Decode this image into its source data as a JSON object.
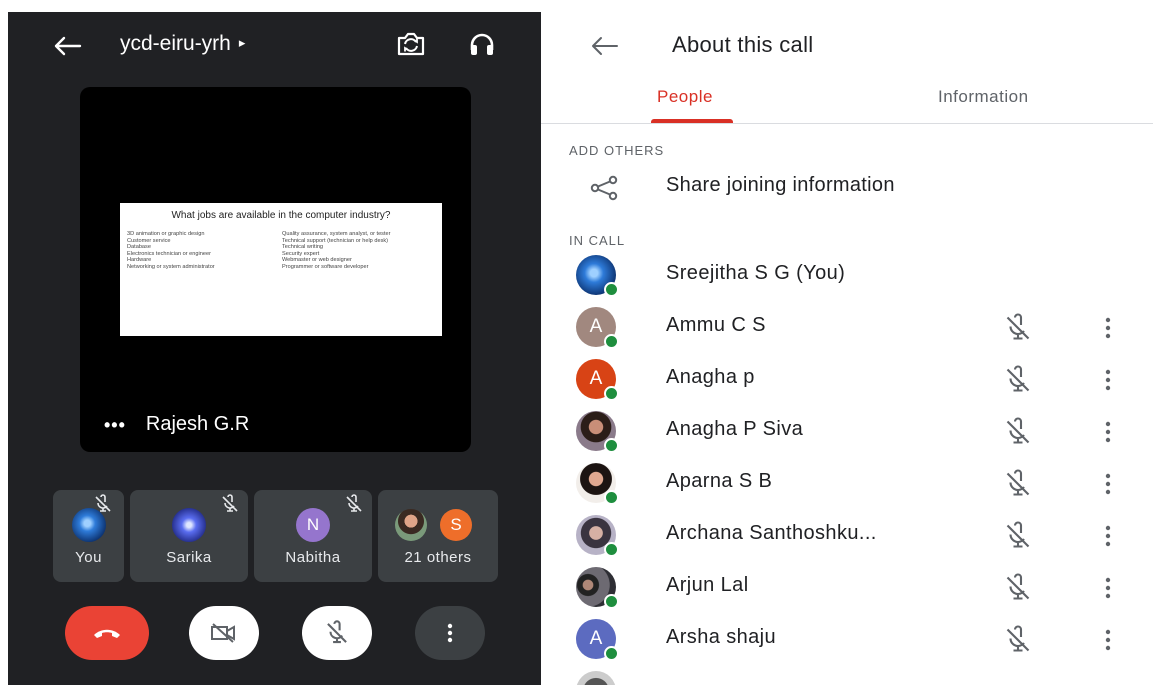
{
  "left": {
    "meeting_code": "ycd-eiru-yrh",
    "meeting_code_caret": "▸",
    "slide": {
      "title": "What jobs are available in the computer industry?",
      "left_items": [
        "3D animation or graphic design",
        "Customer service",
        "Database",
        "Electronics technician or engineer",
        "Hardware",
        "Networking or system administrator"
      ],
      "right_items": [
        "Quality assurance, system analyst, or tester",
        "Technical support (technician or help desk)",
        "Technical writing",
        "Security expert",
        "Webmaster or web designer",
        "Programmer or software developer"
      ]
    },
    "presenter": {
      "dots": "•••",
      "name": "Rajesh G.R"
    },
    "tiles": [
      {
        "name": "You",
        "muted": true,
        "avatar": "blue-globe-photo"
      },
      {
        "name": "Sarika",
        "muted": true,
        "avatar": "blue-flower-photo"
      },
      {
        "name": "Nabitha",
        "muted": true,
        "initial": "N",
        "avatar_color": "#9575cd"
      },
      {
        "name": "21 others",
        "initial": "S",
        "avatar_color": "#ee6e2a"
      }
    ],
    "controls": [
      "end-call",
      "camera-off",
      "mic-off",
      "more-options"
    ],
    "colors": {
      "background": "#202124",
      "end_call": "#ea4335",
      "tile": "#3c4043"
    }
  },
  "right": {
    "title": "About this call",
    "tabs": [
      {
        "label": "People",
        "active": true
      },
      {
        "label": "Information",
        "active": false
      }
    ],
    "sections": {
      "add_others": "ADD OTHERS",
      "in_call": "IN CALL"
    },
    "share_label": "Share joining information",
    "participants": [
      {
        "name": "Sreejitha S G (You)",
        "avatar": "photo",
        "muted": false
      },
      {
        "name": "Ammu C S",
        "initial": "A",
        "avatar_color": "#a1887f",
        "muted": true
      },
      {
        "name": "Anagha p",
        "initial": "A",
        "avatar_color": "#d84315",
        "muted": true
      },
      {
        "name": "Anagha P Siva",
        "avatar": "photo",
        "muted": true
      },
      {
        "name": "Aparna S B",
        "avatar": "photo",
        "muted": true
      },
      {
        "name": "Archana Santhoshku...",
        "avatar": "photo",
        "muted": true
      },
      {
        "name": "Arjun Lal",
        "avatar": "photo",
        "muted": true
      },
      {
        "name": "Arsha shaju",
        "initial": "A",
        "avatar_color": "#5c6bc0",
        "muted": true
      }
    ],
    "colors": {
      "accent": "#d93025",
      "online_dot": "#1e8e3e"
    }
  }
}
